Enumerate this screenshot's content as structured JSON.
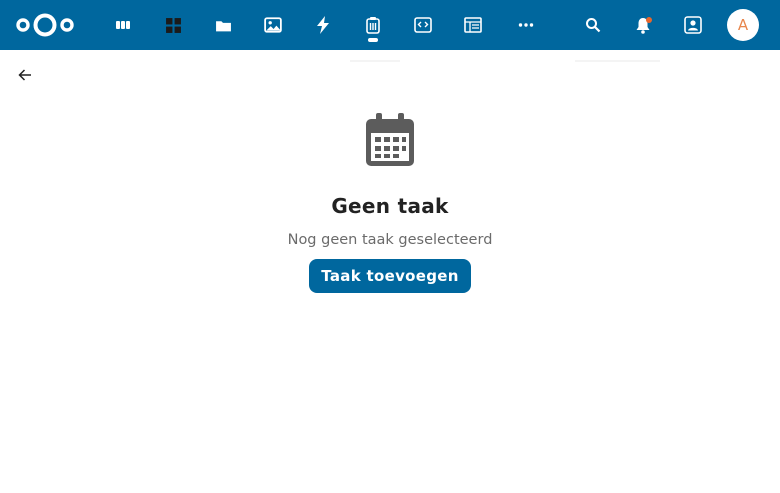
{
  "header": {
    "brand_color": "#00679e",
    "logo": "nextcloud-logo",
    "nav_icons": [
      "deck-icon",
      "dashboard-icon",
      "files-icon",
      "photos-icon",
      "activity-icon",
      "tasks-icon",
      "notes-icon",
      "forms-icon",
      "more-apps-icon"
    ],
    "right_icons": [
      "search-icon",
      "notifications-icon",
      "contacts-icon"
    ],
    "avatar_letter": "A"
  },
  "back": {
    "icon": "arrow-left-icon"
  },
  "empty_state": {
    "icon": "calendar-icon",
    "title": "Geen taak",
    "subtitle": "Nog geen taak geselecteerd",
    "button_label": "Taak toevoegen"
  }
}
